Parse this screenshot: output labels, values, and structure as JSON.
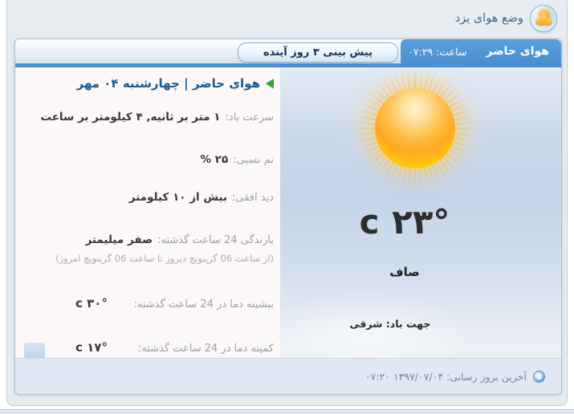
{
  "window": {
    "title": "وضع هوای یزد"
  },
  "tabs": {
    "current_label": "هوای حاضر",
    "time_label": "ساعت: ۰۷:۲۹",
    "forecast_button": "پیش بینی ۳ روز آینده"
  },
  "details": {
    "heading": "هوای حاضر | چهارشنبه ۰۴ مهر",
    "rows": [
      {
        "label": "سرعت باد:",
        "value": "۱ متر بر ثانیه, ۴ کیلومتر بر ساعت"
      },
      {
        "label": "نم نسبی:",
        "value": "۲۵ %"
      },
      {
        "label": "دید افقی:",
        "value": "بیش از ۱۰ کیلومتر"
      },
      {
        "label": "بارندگی 24 ساعت گذشته:",
        "value": "صفر میلیمتر",
        "note": "(از ساعت 06 گرینویچ دیروز تا ساعت 06 گرینویچ امروز)"
      },
      {
        "label": "بیشینه دما در 24 ساعت گذشته:",
        "value": "۳۰° c",
        "split": true
      },
      {
        "label": "کمینه دما در 24 ساعت گذشته:",
        "value": "۱۷° c",
        "split": true
      }
    ]
  },
  "current": {
    "temperature": "۲۳° c",
    "condition": "صاف",
    "wind_direction": "جهت باد: شرقی"
  },
  "footer": {
    "label": "آخرین بروز رسانی:",
    "value": "۱۳۹۷/۰۷/۰۴ ۰۷:۲۰"
  },
  "icons": {
    "header": "sun-behind-cloud-icon",
    "heading_marker": "green-arrow-icon",
    "sun": "sun-graphic",
    "footer": "clock-icon"
  },
  "colors": {
    "accent-blue": "#4a90d2",
    "header-text": "#3a6b96",
    "heading-text": "#1b5a8d",
    "arrow-green": "#2fa337",
    "label-gray": "#99a0a7",
    "value-dark": "#3a3a3a",
    "footer-text": "#7089a6"
  }
}
